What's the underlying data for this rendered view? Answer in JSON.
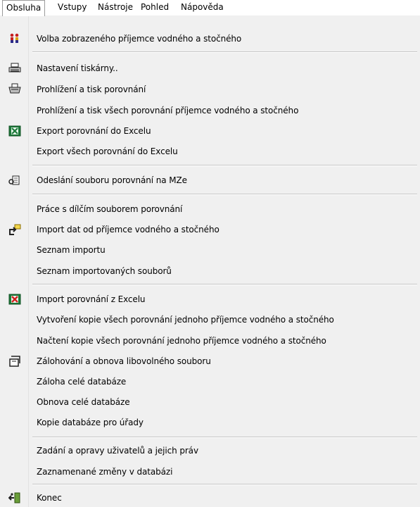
{
  "menubar": {
    "items": [
      "Obsluha",
      "Vstupy",
      "Nástroje",
      "Pohled",
      "Nápověda"
    ]
  },
  "menu": {
    "items": [
      {
        "label": "Volba zobrazeného příjemce vodného a stočného",
        "icon": "people-icon"
      },
      {
        "label": "Nastavení tiskárny..",
        "icon": "printer-setup-icon"
      },
      {
        "label": "Prohlížení a tisk porovnání",
        "icon": "printer-icon"
      },
      {
        "label": "Prohlížení a tisk všech porovnání příjemce vodného a  stočného",
        "icon": ""
      },
      {
        "label": "Export porovnání do Excelu",
        "icon": "excel-icon"
      },
      {
        "label": "Export všech porovnání do Excelu",
        "icon": ""
      },
      {
        "label": "Odeslání souboru porovnání na MZe",
        "icon": "send-file-icon"
      },
      {
        "label": "Práce s dílčím souborem porovnání",
        "icon": ""
      },
      {
        "label": "Import dat od příjemce vodného a stočného",
        "icon": "import-icon"
      },
      {
        "label": "Seznam importu",
        "icon": ""
      },
      {
        "label": "Seznam importovaných souborů",
        "icon": ""
      },
      {
        "label": "Import porovnání z Excelu",
        "icon": "excel-import-icon"
      },
      {
        "label": "Vytvoření kopie všech porovnání jednoho příjemce vodného a stočného",
        "icon": ""
      },
      {
        "label": "Načtení kopie všech porovnání jednoho příjemce vodného a stočného",
        "icon": ""
      },
      {
        "label": "Zálohování a obnova libovolného souboru",
        "icon": "backup-icon"
      },
      {
        "label": "Záloha celé databáze",
        "icon": ""
      },
      {
        "label": "Obnova celé databáze",
        "icon": ""
      },
      {
        "label": "Kopie databáze pro úřady",
        "icon": ""
      },
      {
        "label": "Zadání a opravy uživatelů a jejich práv",
        "icon": ""
      },
      {
        "label": "Zaznamenané změny v databázi",
        "icon": ""
      },
      {
        "label": "Konec",
        "icon": "exit-icon"
      }
    ]
  }
}
